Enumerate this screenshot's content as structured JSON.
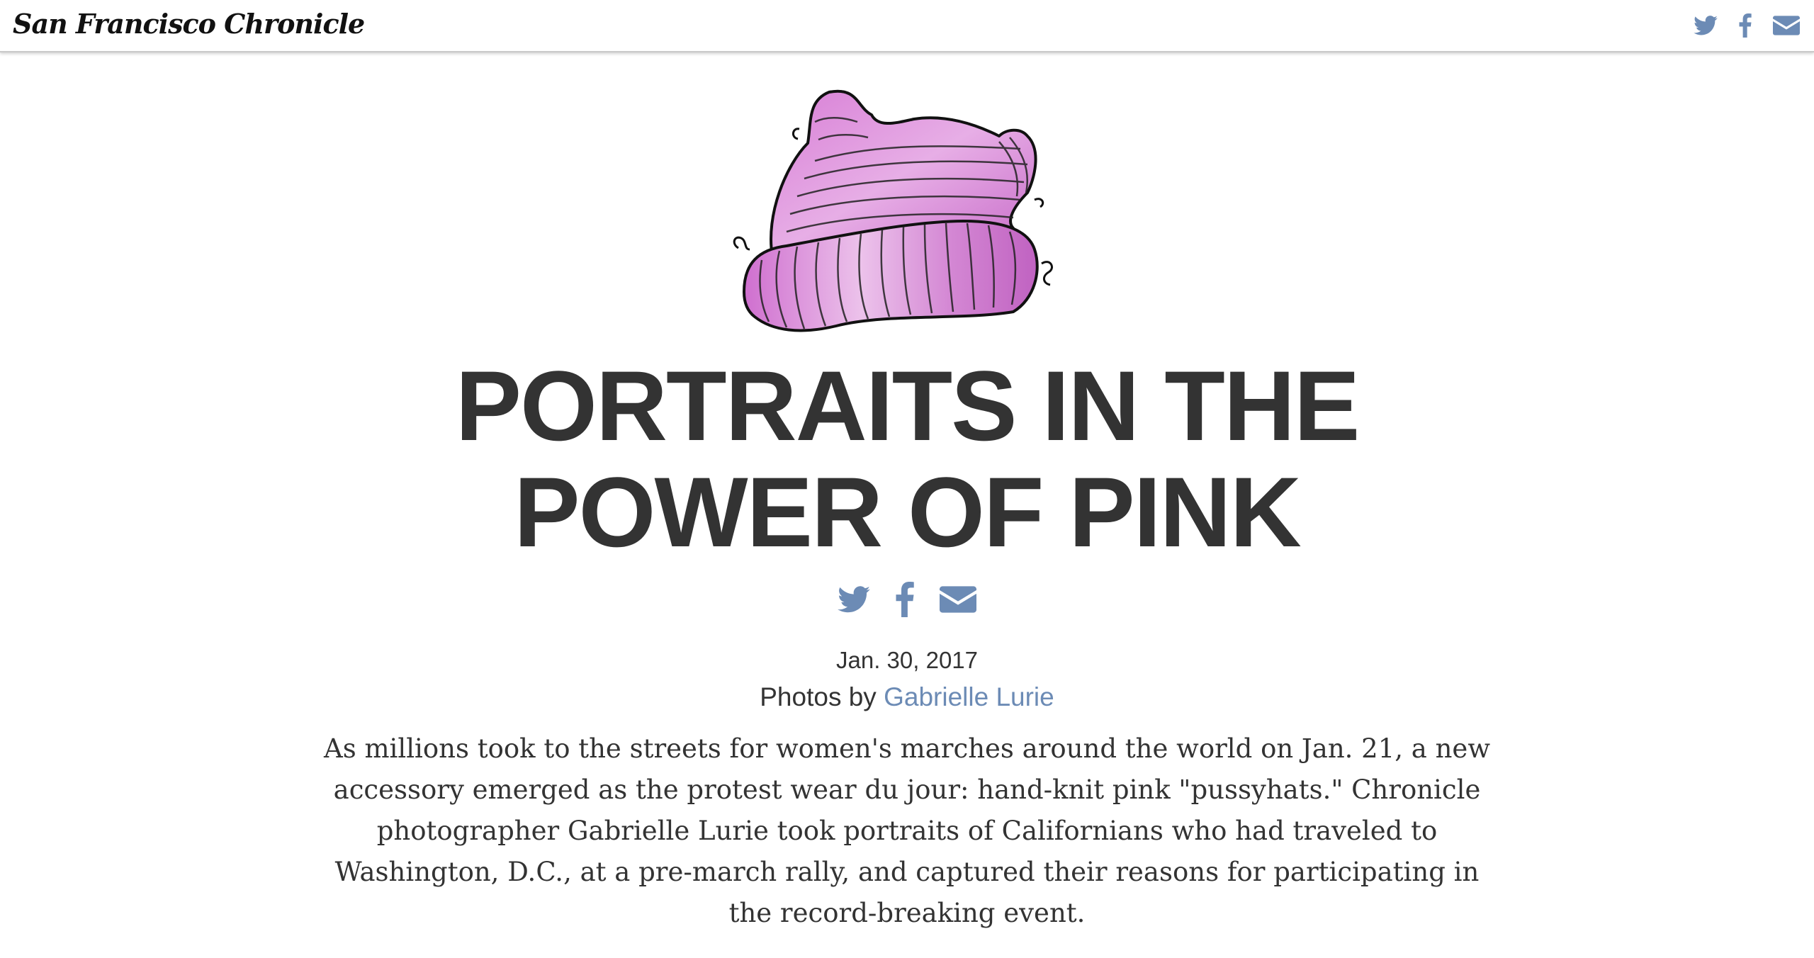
{
  "header": {
    "logo_text": "San Francisco Chronicle",
    "share_icons": [
      "twitter-icon",
      "facebook-icon",
      "email-icon"
    ]
  },
  "hero": {
    "image": "pink-knit-hat-illustration"
  },
  "article": {
    "headline_line1": "PORTRAITS IN THE",
    "headline_line2": "POWER OF PINK",
    "share_icons": [
      "twitter-icon",
      "facebook-icon",
      "email-icon"
    ],
    "date": "Jan. 30, 2017",
    "byline_prefix": "Photos by",
    "byline_author": "Gabrielle Lurie",
    "deck": "As millions took to the streets for women's marches around the world on Jan. 21, a new accessory emerged as the protest wear du jour: hand-knit pink \"pussyhats.\" Chronicle photographer Gabrielle Lurie took portraits of Californians who had traveled to Washington, D.C., at a pre-march rally, and captured their reasons for participating in the record-breaking event."
  },
  "colors": {
    "icon": "#6c8bb5",
    "text": "#333333",
    "link": "#6c8bb5",
    "hat_pink": "#d98ad8"
  }
}
